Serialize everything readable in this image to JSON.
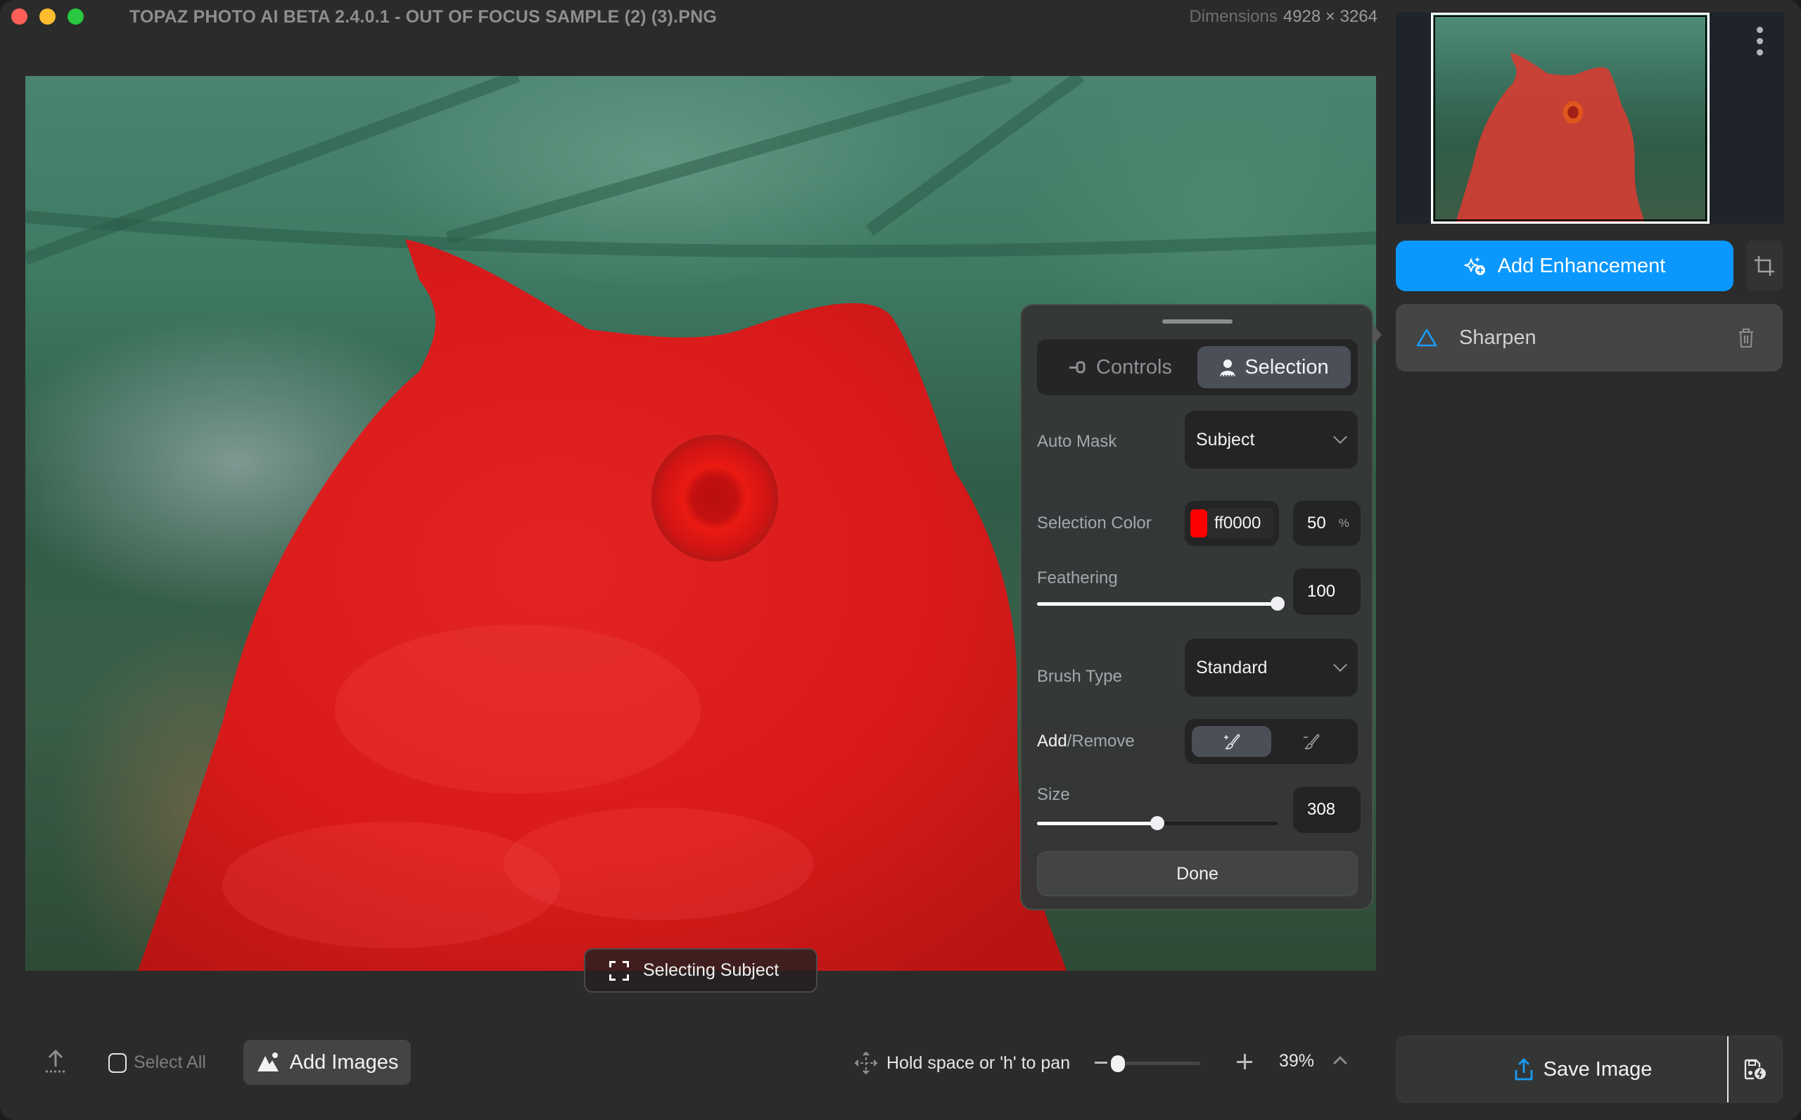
{
  "window": {
    "title": "TOPAZ PHOTO AI BETA 2.4.0.1 - OUT OF FOCUS SAMPLE (2) (3).PNG",
    "dimensions_label": "Dimensions",
    "dimensions_value": "4928 × 3264"
  },
  "canvas": {
    "status_badge": "Selecting Subject",
    "status_icon": "focus-frame-icon",
    "selection_overlay_color": "#ff0000"
  },
  "selection_panel": {
    "tabs": [
      {
        "label": "Controls",
        "icon": "slider-icon",
        "active": false
      },
      {
        "label": "Selection",
        "icon": "subject-select-icon",
        "active": true
      }
    ],
    "auto_mask": {
      "label": "Auto Mask",
      "value": "Subject"
    },
    "selection_color": {
      "label": "Selection Color",
      "hex": "ff0000",
      "swatch": "#ff0000",
      "opacity": "50",
      "opacity_unit": "%"
    },
    "feathering": {
      "label": "Feathering",
      "value": "100",
      "fraction": 1.0
    },
    "brush_type": {
      "label": "Brush Type",
      "value": "Standard"
    },
    "add_remove": {
      "label_add": "Add",
      "label_sep": "/",
      "label_remove": "Remove",
      "active": "add"
    },
    "size": {
      "label": "Size",
      "value": "308",
      "fraction": 0.5
    },
    "done_label": "Done"
  },
  "sidebar": {
    "add_enhancement_label": "Add Enhancement",
    "enhancements": [
      {
        "label": "Sharpen",
        "icon": "triangle-icon",
        "icon_color": "#1a9bf5"
      }
    ],
    "accent": "#0a97fe"
  },
  "bottom_bar": {
    "select_all_label": "Select All",
    "add_images_label": "Add Images",
    "pan_hint": "Hold space or 'h' to pan",
    "zoom_percent": "39%",
    "zoom_fraction": 0.06,
    "save_label": "Save Image"
  }
}
